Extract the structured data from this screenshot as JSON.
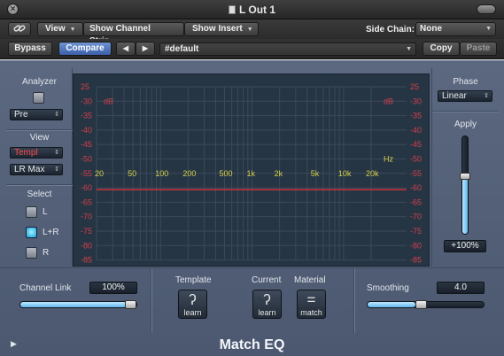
{
  "window": {
    "title": "L Out 1"
  },
  "toolbar": {
    "link_icon": "link-icon",
    "view_label": "View",
    "show_channel_strip_label": "Show Channel Strip",
    "show_insert_label": "Show Insert",
    "side_chain_label": "Side Chain:",
    "side_chain_value": "None",
    "bypass_label": "Bypass",
    "compare_label": "Compare",
    "prev_label": "◀",
    "next_label": "▶",
    "preset_value": "#default",
    "copy_label": "Copy",
    "paste_label": "Paste"
  },
  "analyzer": {
    "label": "Analyzer",
    "position_value": "Pre",
    "checkbox_checked": false
  },
  "view": {
    "label": "View",
    "mode_value": "Templ",
    "max_value": "LR Max"
  },
  "select": {
    "label": "Select",
    "options": [
      {
        "label": "L",
        "checked": false
      },
      {
        "label": "L+R",
        "checked": true
      },
      {
        "label": "R",
        "checked": false
      }
    ]
  },
  "graph": {
    "db_unit_left": "dB",
    "db_unit_right": "dB",
    "hz_unit": "Hz",
    "db_ticks": [
      "25",
      "-30",
      "-35",
      "-40",
      "-45",
      "-50",
      "-55",
      "-60",
      "-65",
      "-70",
      "-75",
      "-80",
      "-85"
    ],
    "db_ticks_right": [
      "25",
      "-30",
      "-35",
      "-40",
      "-45",
      "-50",
      "-55",
      "-60",
      "-65",
      "-70",
      "-75",
      "-80",
      "-85"
    ],
    "freq_ticks": [
      "20",
      "50",
      "100",
      "200",
      "500",
      "1k",
      "2k",
      "5k",
      "10k",
      "20k"
    ],
    "colors": {
      "grid": "#3b4a5a",
      "db_labels": "#d2404a",
      "freq_labels": "#d6d24a",
      "curve": "#c8323c"
    }
  },
  "phase": {
    "label": "Phase",
    "value": "Linear"
  },
  "apply": {
    "label": "Apply",
    "value": "+100%",
    "level": 0.6
  },
  "channel_link": {
    "label": "Channel Link",
    "value": "100%",
    "level": 1.0
  },
  "template": {
    "label": "Template",
    "button_caption": "learn"
  },
  "current": {
    "label": "Current",
    "button_caption": "learn"
  },
  "material": {
    "label": "Material",
    "button_caption": "match"
  },
  "smoothing": {
    "label": "Smoothing",
    "value": "4.0",
    "level": 0.45
  },
  "footer": {
    "plugin_name": "Match EQ",
    "disclosure_icon": "disclosure-triangle-icon"
  }
}
